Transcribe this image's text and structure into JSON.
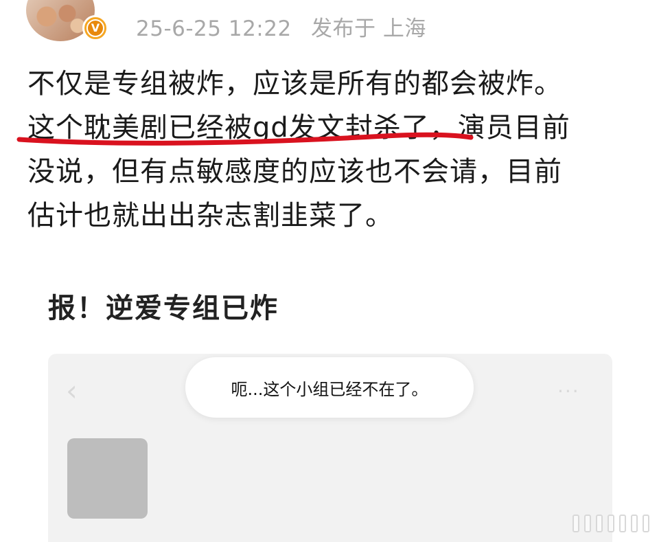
{
  "post_header": {
    "timestamp": "25-6-25 12:22",
    "location": "发布于 上海",
    "verified_badge": "V"
  },
  "post_body": {
    "lines": [
      "不仅是专组被炸，应该是所有的都会被炸。",
      "这个耽美剧已经被gd发文封杀了，演员目前",
      "没说，但有点敏感度的应该也不会请，目前",
      "估计也就出出杂志割韭菜了。"
    ],
    "underline_color": "#d9121f"
  },
  "shared_image": {
    "title": "报！逆爱专组已炸",
    "toast_text": "呃...这个小组已经不在了。",
    "back_icon": "chevron-left-icon",
    "more_icon": "more-dots-icon"
  },
  "icons": [
    "avatar",
    "verified-badge-icon",
    "chevron-left-icon",
    "more-dots-icon",
    "watermark-icon"
  ]
}
